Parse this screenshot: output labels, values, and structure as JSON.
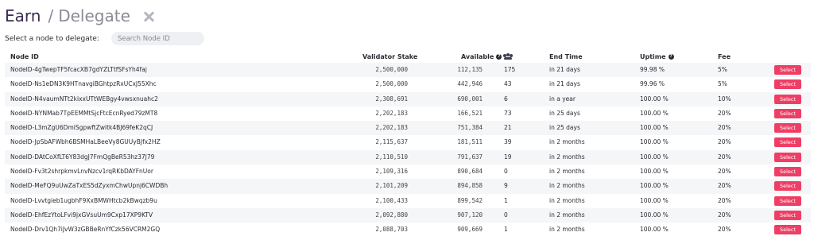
{
  "header": {
    "title": "Earn",
    "separator": "/",
    "subtitle": "Delegate"
  },
  "search": {
    "label": "Select a node to delegate:",
    "placeholder": "Search Node ID",
    "value": ""
  },
  "table": {
    "columns": {
      "node_id": "Node ID",
      "validator_stake": "Validator Stake",
      "available": "Available",
      "end_time": "End Time",
      "uptime": "Uptime",
      "fee": "Fee"
    },
    "rows": [
      {
        "node_id": "NodeID-4gTwepTF5fcacXB7gdYZLTtfSFsYh4faj",
        "stake": "2,500,000",
        "available": "112,135",
        "delegators": "175",
        "end_time": "in 21 days",
        "uptime": "99.98 %",
        "fee": "5%",
        "action": "Select"
      },
      {
        "node_id": "NodeID-Ns1eDN3K9HTnavgiBGhtpzRxUCxJ55Xhc",
        "stake": "2,500,000",
        "available": "442,946",
        "delegators": "43",
        "end_time": "in 21 days",
        "uptime": "99.96 %",
        "fee": "5%",
        "action": "Select"
      },
      {
        "node_id": "NodeID-N4vaumNTt2kixxUTtWEBgy4vwsxnuahc2",
        "stake": "2,308,691",
        "available": "690,001",
        "delegators": "6",
        "end_time": "in a year",
        "uptime": "100.00 %",
        "fee": "10%",
        "action": "Select"
      },
      {
        "node_id": "NodeID-NYNMab7TpEEMMtSjcFtcEcnRyed79zMT8",
        "stake": "2,202,183",
        "available": "166,521",
        "delegators": "73",
        "end_time": "in 25 days",
        "uptime": "100.00 %",
        "fee": "20%",
        "action": "Select"
      },
      {
        "node_id": "NodeID-L3mZgU6DmiSgpwftZwitk4BJ69feK2qCJ",
        "stake": "2,202,183",
        "available": "751,384",
        "delegators": "21",
        "end_time": "in 25 days",
        "uptime": "100.00 %",
        "fee": "20%",
        "action": "Select"
      },
      {
        "node_id": "NodeID-JpSbAFWbh6BSMHaLBeeVy8GUUyBJfx2HZ",
        "stake": "2,115,637",
        "available": "181,511",
        "delegators": "39",
        "end_time": "in 2 months",
        "uptime": "100.00 %",
        "fee": "20%",
        "action": "Select"
      },
      {
        "node_id": "NodeID-DAtCoXfLT6Y83dgJ7FmQgBeR53hz37J79",
        "stake": "2,110,510",
        "available": "791,637",
        "delegators": "19",
        "end_time": "in 2 months",
        "uptime": "100.00 %",
        "fee": "20%",
        "action": "Select"
      },
      {
        "node_id": "NodeID-Fv3t2shrpkmvLnvNzcv1rqRKbDAYFnUor",
        "stake": "2,109,316",
        "available": "890,684",
        "delegators": "0",
        "end_time": "in 2 months",
        "uptime": "100.00 %",
        "fee": "20%",
        "action": "Select"
      },
      {
        "node_id": "NodeID-MeFQ9uUwZaTxES5dZyxmChwUpnj6CWDBh",
        "stake": "2,101,209",
        "available": "894,858",
        "delegators": "9",
        "end_time": "in 2 months",
        "uptime": "100.00 %",
        "fee": "20%",
        "action": "Select"
      },
      {
        "node_id": "NodeID-Lvvtgieb1ugbhF9XxBMWHtcb2kBwqzb9u",
        "stake": "2,100,433",
        "available": "899,542",
        "delegators": "1",
        "end_time": "in 2 months",
        "uptime": "100.00 %",
        "fee": "20%",
        "action": "Select"
      },
      {
        "node_id": "NodeID-EhfEzYtoLFvi9jxGVsuUm9Cxp17XP9KTV",
        "stake": "2,092,880",
        "available": "907,120",
        "delegators": "0",
        "end_time": "in 2 months",
        "uptime": "100.00 %",
        "fee": "20%",
        "action": "Select"
      },
      {
        "node_id": "NodeID-Drv1Qh7iJvW3zGBBeRnYfCzk56VCRM2GQ",
        "stake": "2,088,703",
        "available": "909,669",
        "delegators": "1",
        "end_time": "in 2 months",
        "uptime": "100.00 %",
        "fee": "20%",
        "action": "Select"
      }
    ]
  },
  "icons": {
    "close": "close-icon",
    "info": "info-icon",
    "delegators": "users-icon"
  },
  "colors": {
    "accent": "#ef3e65",
    "title": "#3b2a4f",
    "row_stripe": "#f5f6f8"
  }
}
